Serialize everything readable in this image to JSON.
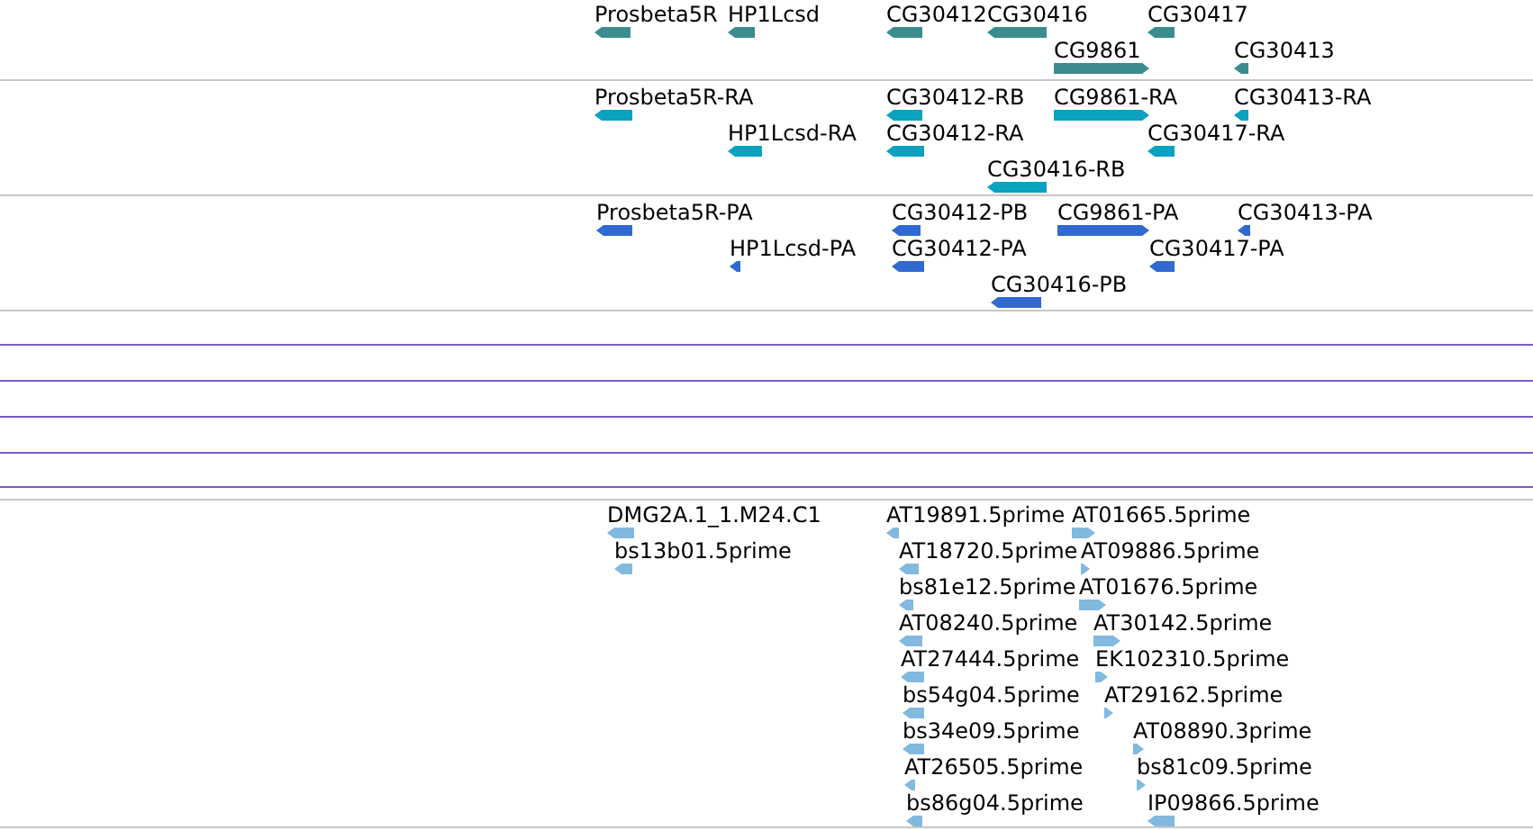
{
  "tracks": [
    {
      "color": "#3b8c8e",
      "features": [
        {
          "label": "Prosbeta5R",
          "reverse": true
        },
        {
          "label": "HP1Lcsd",
          "reverse": true
        },
        {
          "label": "CG30412",
          "reverse": true
        },
        {
          "label": "CG30416",
          "reverse": true
        },
        {
          "label": "CG30417",
          "reverse": true
        },
        {
          "label": "CG9861",
          "reverse": false
        },
        {
          "label": "CG30413",
          "reverse": true
        }
      ]
    },
    {
      "color": "#0aa2c0",
      "features": [
        {
          "label": "Prosbeta5R-RA",
          "reverse": true
        },
        {
          "label": "CG30412-RB",
          "reverse": true
        },
        {
          "label": "CG9861-RA",
          "reverse": false
        },
        {
          "label": "CG30413-RA",
          "reverse": true
        },
        {
          "label": "HP1Lcsd-RA",
          "reverse": true
        },
        {
          "label": "CG30412-RA",
          "reverse": true
        },
        {
          "label": "CG30417-RA",
          "reverse": true
        },
        {
          "label": "CG30416-RB",
          "reverse": true
        }
      ]
    },
    {
      "color": "#3069d1",
      "features": [
        {
          "label": "Prosbeta5R-PA",
          "reverse": true
        },
        {
          "label": "CG30412-PB",
          "reverse": true
        },
        {
          "label": "CG9861-PA",
          "reverse": false
        },
        {
          "label": "CG30413-PA",
          "reverse": true
        },
        {
          "label": "HP1Lcsd-PA",
          "reverse": true
        },
        {
          "label": "CG30412-PA",
          "reverse": true
        },
        {
          "label": "CG30417-PA",
          "reverse": true
        },
        {
          "label": "CG30416-PB",
          "reverse": true
        }
      ]
    },
    {
      "color": "#82b9de",
      "features": [
        {
          "label": "DMG2A.1_1.M24.C1",
          "reverse": true
        },
        {
          "label": "bs13b01.5prime",
          "reverse": true
        },
        {
          "label": "AT19891.5prime",
          "reverse": true
        },
        {
          "label": "AT01665.5prime",
          "reverse": false
        },
        {
          "label": "AT18720.5prime",
          "reverse": true
        },
        {
          "label": "AT09886.5prime",
          "reverse": false
        },
        {
          "label": "bs81e12.5prime",
          "reverse": true
        },
        {
          "label": "AT01676.5prime",
          "reverse": false
        },
        {
          "label": "AT08240.5prime",
          "reverse": true
        },
        {
          "label": "AT30142.5prime",
          "reverse": false
        },
        {
          "label": "AT27444.5prime",
          "reverse": true
        },
        {
          "label": "EK102310.5prime",
          "reverse": false
        },
        {
          "label": "bs54g04.5prime",
          "reverse": true
        },
        {
          "label": "AT29162.5prime",
          "reverse": false
        },
        {
          "label": "bs34e09.5prime",
          "reverse": true
        },
        {
          "label": "AT08890.3prime",
          "reverse": false
        },
        {
          "label": "AT26505.5prime",
          "reverse": true
        },
        {
          "label": "bs81c09.5prime",
          "reverse": false
        },
        {
          "label": "bs86g04.5prime",
          "reverse": true
        },
        {
          "label": "IP09866.5prime",
          "reverse": true
        }
      ]
    }
  ]
}
